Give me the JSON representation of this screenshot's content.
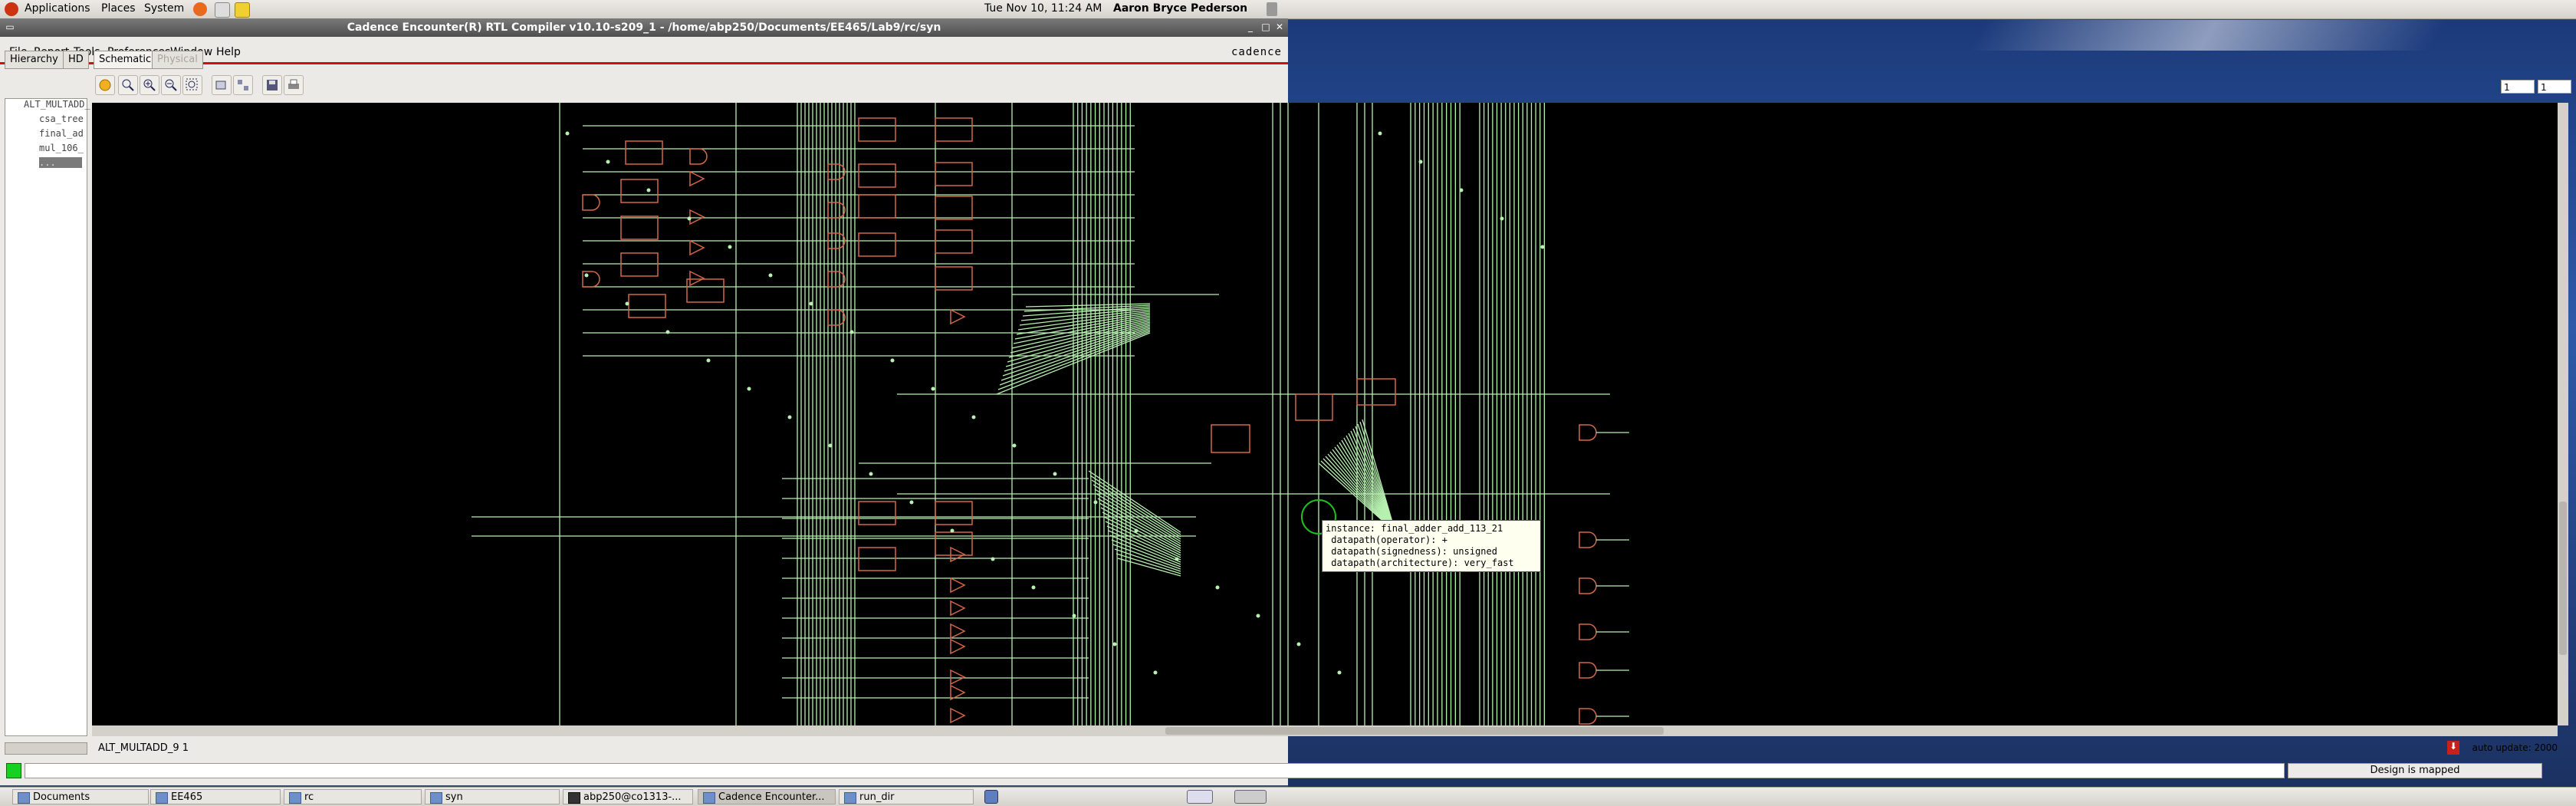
{
  "top_panel": {
    "menus": [
      "Applications",
      "Places",
      "System"
    ],
    "clock": "Tue Nov 10, 11:24 AM",
    "user": "Aaron Bryce Pederson"
  },
  "window": {
    "title": "Cadence Encounter(R) RTL Compiler v10.10-s209_1 - /home/abp250/Documents/EE465/Lab9/rc/syn",
    "brand": "cadence"
  },
  "menubar": [
    "File",
    "Report",
    "Tools",
    "Preferences",
    "Window",
    "Help"
  ],
  "tabs": [
    {
      "label": "Hierarchy",
      "state": "normal"
    },
    {
      "label": "HD",
      "state": "normal"
    },
    {
      "label": "Schematic",
      "state": "active"
    },
    {
      "label": "Physical",
      "state": "disabled"
    }
  ],
  "pager": {
    "page": "1",
    "of": "1"
  },
  "tree": {
    "items": [
      "ALT_MULTADD_",
      "csa_tree",
      "final_ad",
      "mul_106_",
      "..."
    ]
  },
  "tooltip": {
    "lines": [
      "instance: final_adder_add_113_21",
      " datapath(operator): +",
      " datapath(signedness): unsigned",
      " datapath(architecture): very_fast"
    ]
  },
  "status": {
    "instance_path": "ALT_MULTADD_9 1",
    "auto_update": "auto update: 2000",
    "design_state": "Design is mapped"
  },
  "taskbar": [
    {
      "label": "Documents",
      "kind": "folder"
    },
    {
      "label": "EE465",
      "kind": "folder"
    },
    {
      "label": "rc",
      "kind": "folder"
    },
    {
      "label": "syn",
      "kind": "folder"
    },
    {
      "label": "abp250@co1313-...",
      "kind": "terminal"
    },
    {
      "label": "Cadence Encounter...",
      "kind": "app",
      "active": true
    },
    {
      "label": "run_dir",
      "kind": "folder"
    }
  ],
  "colors": {
    "wire": "#b7f0b0",
    "cell": "#d4664a",
    "schematic_bg": "#000000",
    "accent": "#cc1111"
  }
}
